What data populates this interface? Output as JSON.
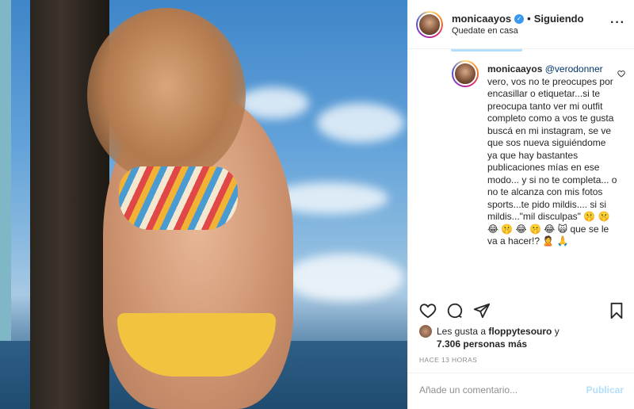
{
  "post": {
    "username": "monicaayos",
    "separator": "•",
    "follow_state": "Siguiendo",
    "subtitle": "Quedate en casa",
    "more_icon": "more-options-icon"
  },
  "comment": {
    "username": "monicaayos",
    "mention": "@verodonner",
    "text": "vero, vos no te preocupes por encasillar o etiquetar...si te preocupa tanto ver mi outfit completo como a vos te gusta buscá en mi instagram, se ve que sos nueva siguiéndome ya que hay bastantes publicaciones mías en ese modo... y si no te completa... o no te alcanza con mis fotos sports...te pido mildis.... si si mildis...\"mil disculpas\" 🤫 🤫 😂 🤫 😂 🤫 😂 🙀 que se le va a hacer!? 🙎 🙏"
  },
  "actions": {
    "icons": [
      "heart-icon",
      "comment-icon",
      "share-icon",
      "bookmark-icon"
    ]
  },
  "likes": {
    "prefix": "Les gusta a",
    "user": "floppytesouro",
    "suffix": "y",
    "others": "7.306 personas más"
  },
  "time": "HACE 13 HORAS",
  "comment_box": {
    "placeholder": "Añade un comentario...",
    "publish_label": "Publicar"
  }
}
